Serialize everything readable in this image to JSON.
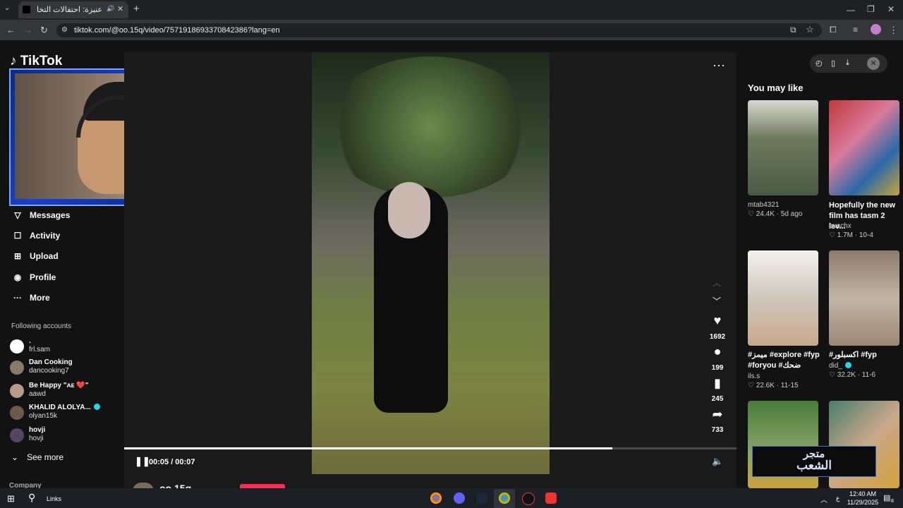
{
  "browser": {
    "tab_title": "مهرجان عنيزة: احتفالات التخا...",
    "new_tab_label": "+",
    "url": "tiktok.com/@oo.15q/video/7571918693370842386?lang=en",
    "window_controls": [
      "—",
      "❐",
      "✕"
    ]
  },
  "sidebar": {
    "logo": "TikTok",
    "nav": [
      {
        "label": "Messages",
        "icon": "messages-icon"
      },
      {
        "label": "Activity",
        "icon": "activity-icon"
      },
      {
        "label": "Upload",
        "icon": "upload-icon"
      },
      {
        "label": "Profile",
        "icon": "profile-icon"
      },
      {
        "label": "More",
        "icon": "more-icon"
      }
    ],
    "following_title": "Following accounts",
    "accounts": [
      {
        "name": ".",
        "handle": "frl.sam",
        "verified": false
      },
      {
        "name": "Dan Cooking",
        "handle": "dancooking7",
        "verified": false
      },
      {
        "name": "Be Happy \"ᴀᴇ ❤️\"",
        "handle": "aawd",
        "verified": false
      },
      {
        "name": "KHALID ALOLYA...",
        "handle": "olyan15k",
        "verified": true
      },
      {
        "name": "hovji",
        "handle": "hovji",
        "verified": false
      }
    ],
    "see_more": "See more",
    "company": "Company"
  },
  "player": {
    "current_time": "00:05",
    "duration": "00:07",
    "time_display": "00:05 / 00:07",
    "progress_fraction": 0.797,
    "author_handle": "oo.15q",
    "actions": [
      {
        "icon": "heart-icon",
        "count": "1692"
      },
      {
        "icon": "comment-icon",
        "count": "199"
      },
      {
        "icon": "bookmark-icon",
        "count": "245"
      },
      {
        "icon": "share-icon",
        "count": "733"
      }
    ]
  },
  "recommend": {
    "title": "You may like",
    "cards": [
      {
        "title": "",
        "author": "mtab4321",
        "likes": "24.4K",
        "date": "5d ago",
        "color": "#6d7a5c"
      },
      {
        "title": "Hopefully the new film has tasm 2 lev...",
        "author": "buschx",
        "likes": "1.7M",
        "date": "10-4",
        "color": "#a83a3a"
      },
      {
        "title": "#ميمز #explore #fyp #foryou #ضحك",
        "author": "ils.s",
        "likes": "22.6K",
        "date": "11-15",
        "color": "#cfc7bd"
      },
      {
        "title": "#اكسبلور #fyp",
        "author": "did_",
        "likes": "32.2K",
        "date": "11-6",
        "color": "#9a8874"
      },
      {
        "title": "",
        "author": "",
        "likes": "",
        "date": "",
        "color": "#6e8a4a"
      },
      {
        "title": "",
        "author": "",
        "likes": "",
        "date": "",
        "color": "#4a7d6d"
      }
    ]
  },
  "overlay": {
    "line1": "متجر",
    "line2": "الشعب"
  },
  "taskbar": {
    "search_label": "Links",
    "time": "12:40 AM",
    "date": "11/29/2025",
    "notification_count": "8"
  }
}
